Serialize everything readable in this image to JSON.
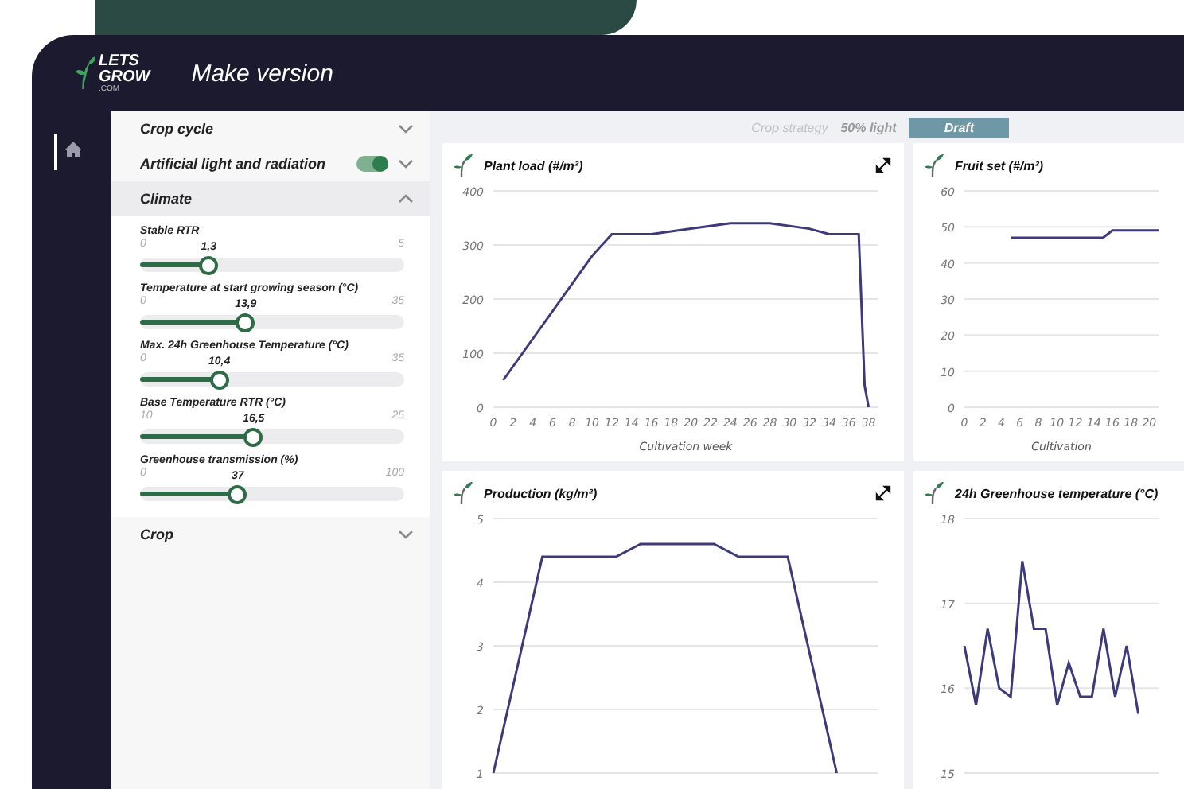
{
  "logo": {
    "line_1": "LETS",
    "line_2": "GROW",
    "line_3": ".COM"
  },
  "window": {
    "title": "Make version"
  },
  "sidebar": {
    "items": [
      {
        "selected": true
      }
    ]
  },
  "strategy_bar": {
    "label": "Crop strategy",
    "value": "50% light",
    "badge": "Draft"
  },
  "settings": [
    {
      "kind": "section",
      "title": "Crop cycle",
      "expanded": false
    },
    {
      "kind": "toggle",
      "title": "Artificial light and radiation",
      "on": true,
      "expanded": false
    },
    {
      "kind": "section",
      "title": "Climate",
      "expanded": true,
      "sliders": [
        {
          "label": "Stable RTR",
          "min": "0",
          "value": "1,3",
          "max": "5",
          "level": 0.26
        },
        {
          "label": "Temperature at start growing season (°C)",
          "min": "0",
          "value": "13,9",
          "max": "35",
          "level": 0.4
        },
        {
          "label": "Max. 24h Greenhouse Temperature (°C)",
          "min": "0",
          "value": "10,4",
          "max": "35",
          "level": 0.3
        },
        {
          "label": "Base Temperature RTR (°C)",
          "min": "10",
          "value": "16,5",
          "max": "25",
          "level": 0.43
        },
        {
          "label": "Greenhouse transmission (%)",
          "min": "0",
          "value": "37",
          "max": "100",
          "level": 0.37
        }
      ]
    },
    {
      "kind": "section",
      "title": "Crop",
      "expanded": false
    }
  ],
  "charts": [
    {
      "title": "Plant load (#/m²)",
      "expandable": true,
      "chart_data": {
        "type": "line",
        "xlabel": "Cultivation week",
        "xlim": [
          0,
          39
        ],
        "ylim": [
          0,
          400
        ],
        "xticks": [
          0,
          2,
          4,
          6,
          8,
          10,
          12,
          14,
          16,
          18,
          20,
          22,
          24,
          26,
          28,
          30,
          32,
          34,
          36,
          38
        ],
        "yticks": [
          0,
          100,
          200,
          300,
          400
        ],
        "grid": true,
        "series": [
          {
            "color": "#3d3a7a",
            "x": [
              1,
              10,
              12,
              16,
              20,
              24,
              28,
              32,
              34,
              37,
              37.6,
              38
            ],
            "values": [
              50,
              280,
              320,
              320,
              330,
              340,
              340,
              330,
              320,
              320,
              40,
              0
            ]
          }
        ]
      }
    },
    {
      "title": "Fruit set (#/m²)",
      "expandable": false,
      "chart_data": {
        "type": "line",
        "xlabel": "Cultivation",
        "xlim": [
          0,
          21
        ],
        "ylim": [
          0,
          60
        ],
        "xticks": [
          0,
          2,
          4,
          6,
          8,
          10,
          12,
          14,
          16,
          18,
          20
        ],
        "yticks": [
          0,
          10,
          20,
          30,
          40,
          50,
          60
        ],
        "grid": true,
        "series": [
          {
            "color": "#3d3a7a",
            "x": [
              5,
              15,
              16,
              21
            ],
            "values": [
              47,
              47,
              49,
              49
            ]
          }
        ]
      }
    },
    {
      "title": "Production (kg/m²)",
      "expandable": true,
      "chart_data": {
        "type": "line",
        "ylim": [
          1,
          5
        ],
        "yticks": [
          1,
          2,
          3,
          4,
          5
        ],
        "grid": true,
        "categories": [
          null,
          null,
          null,
          null,
          null,
          null,
          null,
          null,
          null,
          null,
          null,
          null,
          null,
          null,
          null
        ],
        "series": [
          {
            "color": "#3d3a7a",
            "values": [
              1,
              2.7,
              4.4,
              4.4,
              4.4,
              4.4,
              4.6,
              4.6,
              4.6,
              4.6,
              4.4,
              4.4,
              4.4,
              2.7,
              1
            ]
          }
        ]
      }
    },
    {
      "title": "24h Greenhouse temperature (°C)",
      "expandable": false,
      "chart_data": {
        "type": "line",
        "ylim": [
          15,
          18
        ],
        "yticks": [
          15,
          16,
          17,
          18
        ],
        "grid": true,
        "categories": [
          null,
          null,
          null,
          null,
          null,
          null,
          null,
          null,
          null,
          null,
          null,
          null,
          null,
          null,
          null,
          null
        ],
        "series": [
          {
            "color": "#3d3a7a",
            "values": [
              16.5,
              15.8,
              16.7,
              16,
              15.9,
              17.5,
              16.7,
              16.7,
              15.8,
              16.3,
              15.9,
              15.9,
              16.7,
              15.9,
              16.5,
              15.7
            ]
          }
        ]
      }
    }
  ]
}
